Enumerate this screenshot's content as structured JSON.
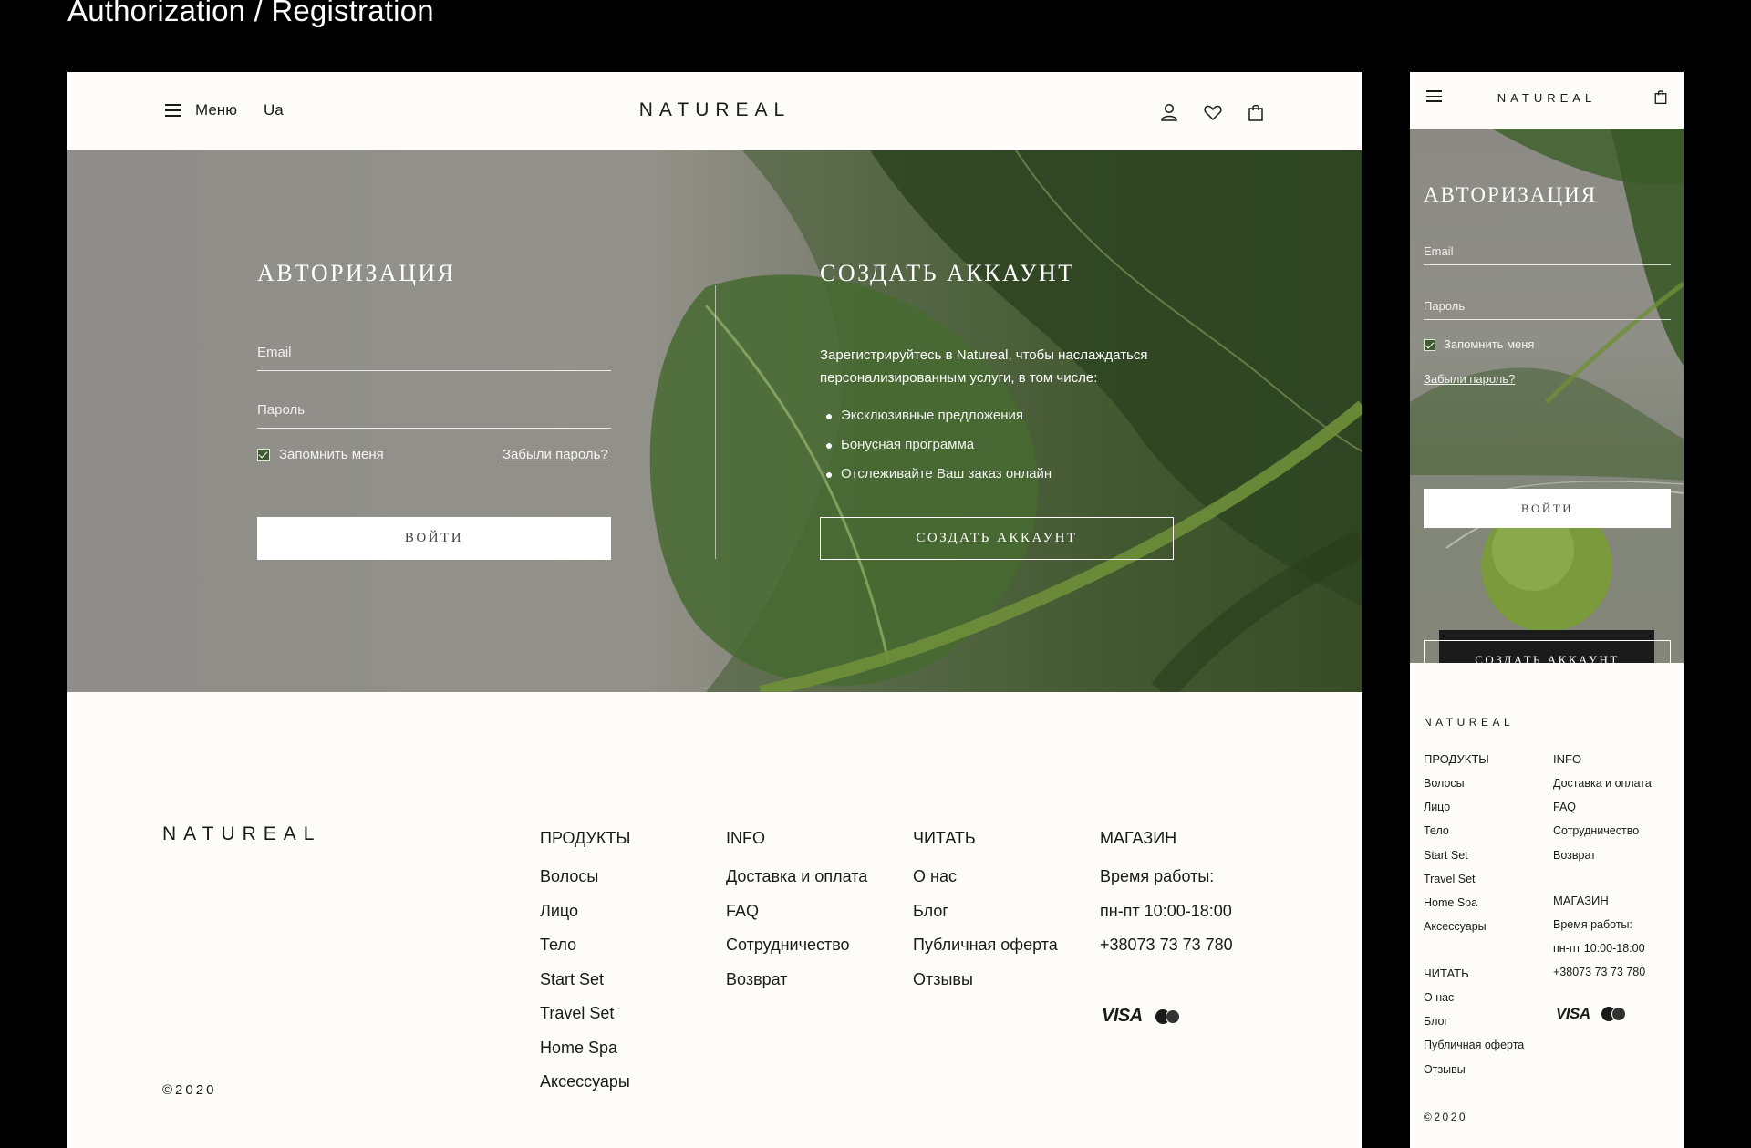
{
  "page_title": "Authorization / Registration",
  "header": {
    "menu_label": "Меню",
    "lang_label": "Ua",
    "logo": "NATUREAL",
    "icons": [
      "user-icon",
      "heart-icon",
      "bag-icon"
    ]
  },
  "login": {
    "title": "АВТОРИЗАЦИЯ",
    "email_placeholder": "Email",
    "password_placeholder": "Пароль",
    "remember_label": "Запомнить меня",
    "remember_checked": true,
    "forgot_link": "Забыли пароль?",
    "submit_label": "ВОЙТИ"
  },
  "register": {
    "title": "СОЗДАТЬ АККАУНТ",
    "intro": "Зарегистрируйтесь в Natureal, чтобы наслаждаться персонализированным услуги, в том числе:",
    "benefits": [
      "Эксклюзивные предложения",
      "Бонусная программа",
      "Отслеживайте Ваш заказ онлайн"
    ],
    "button_label": "СОЗДАТЬ АККАУНТ"
  },
  "footer": {
    "logo": "NATUREAL",
    "copyright": "©2020",
    "columns": [
      {
        "title": "ПРОДУКТЫ",
        "items": [
          "Волосы",
          "Лицо",
          "Тело",
          "Start Set",
          "Travel Set",
          "Home Spa",
          "Аксессуары"
        ]
      },
      {
        "title": "INFO",
        "items": [
          "Доставка и оплата",
          "FAQ",
          "Сотрудничество",
          "Возврат"
        ]
      },
      {
        "title": "ЧИТАТЬ",
        "items": [
          "О нас",
          "Блог",
          "Публичная оферта",
          "Отзывы"
        ]
      },
      {
        "title": "МАГАЗИН",
        "items": [
          "Время работы:",
          "пн-пт 10:00-18:00",
          "+38073 73 73 780"
        ]
      }
    ],
    "payment": {
      "visa": "VISA",
      "mastercard": "MasterCard"
    }
  },
  "colors": {
    "background": "#000000",
    "panel": "#fdfcf8",
    "text": "#1a1a1a",
    "checkbox": "#3f5a33",
    "leaf_green": "#3e5a2c"
  }
}
